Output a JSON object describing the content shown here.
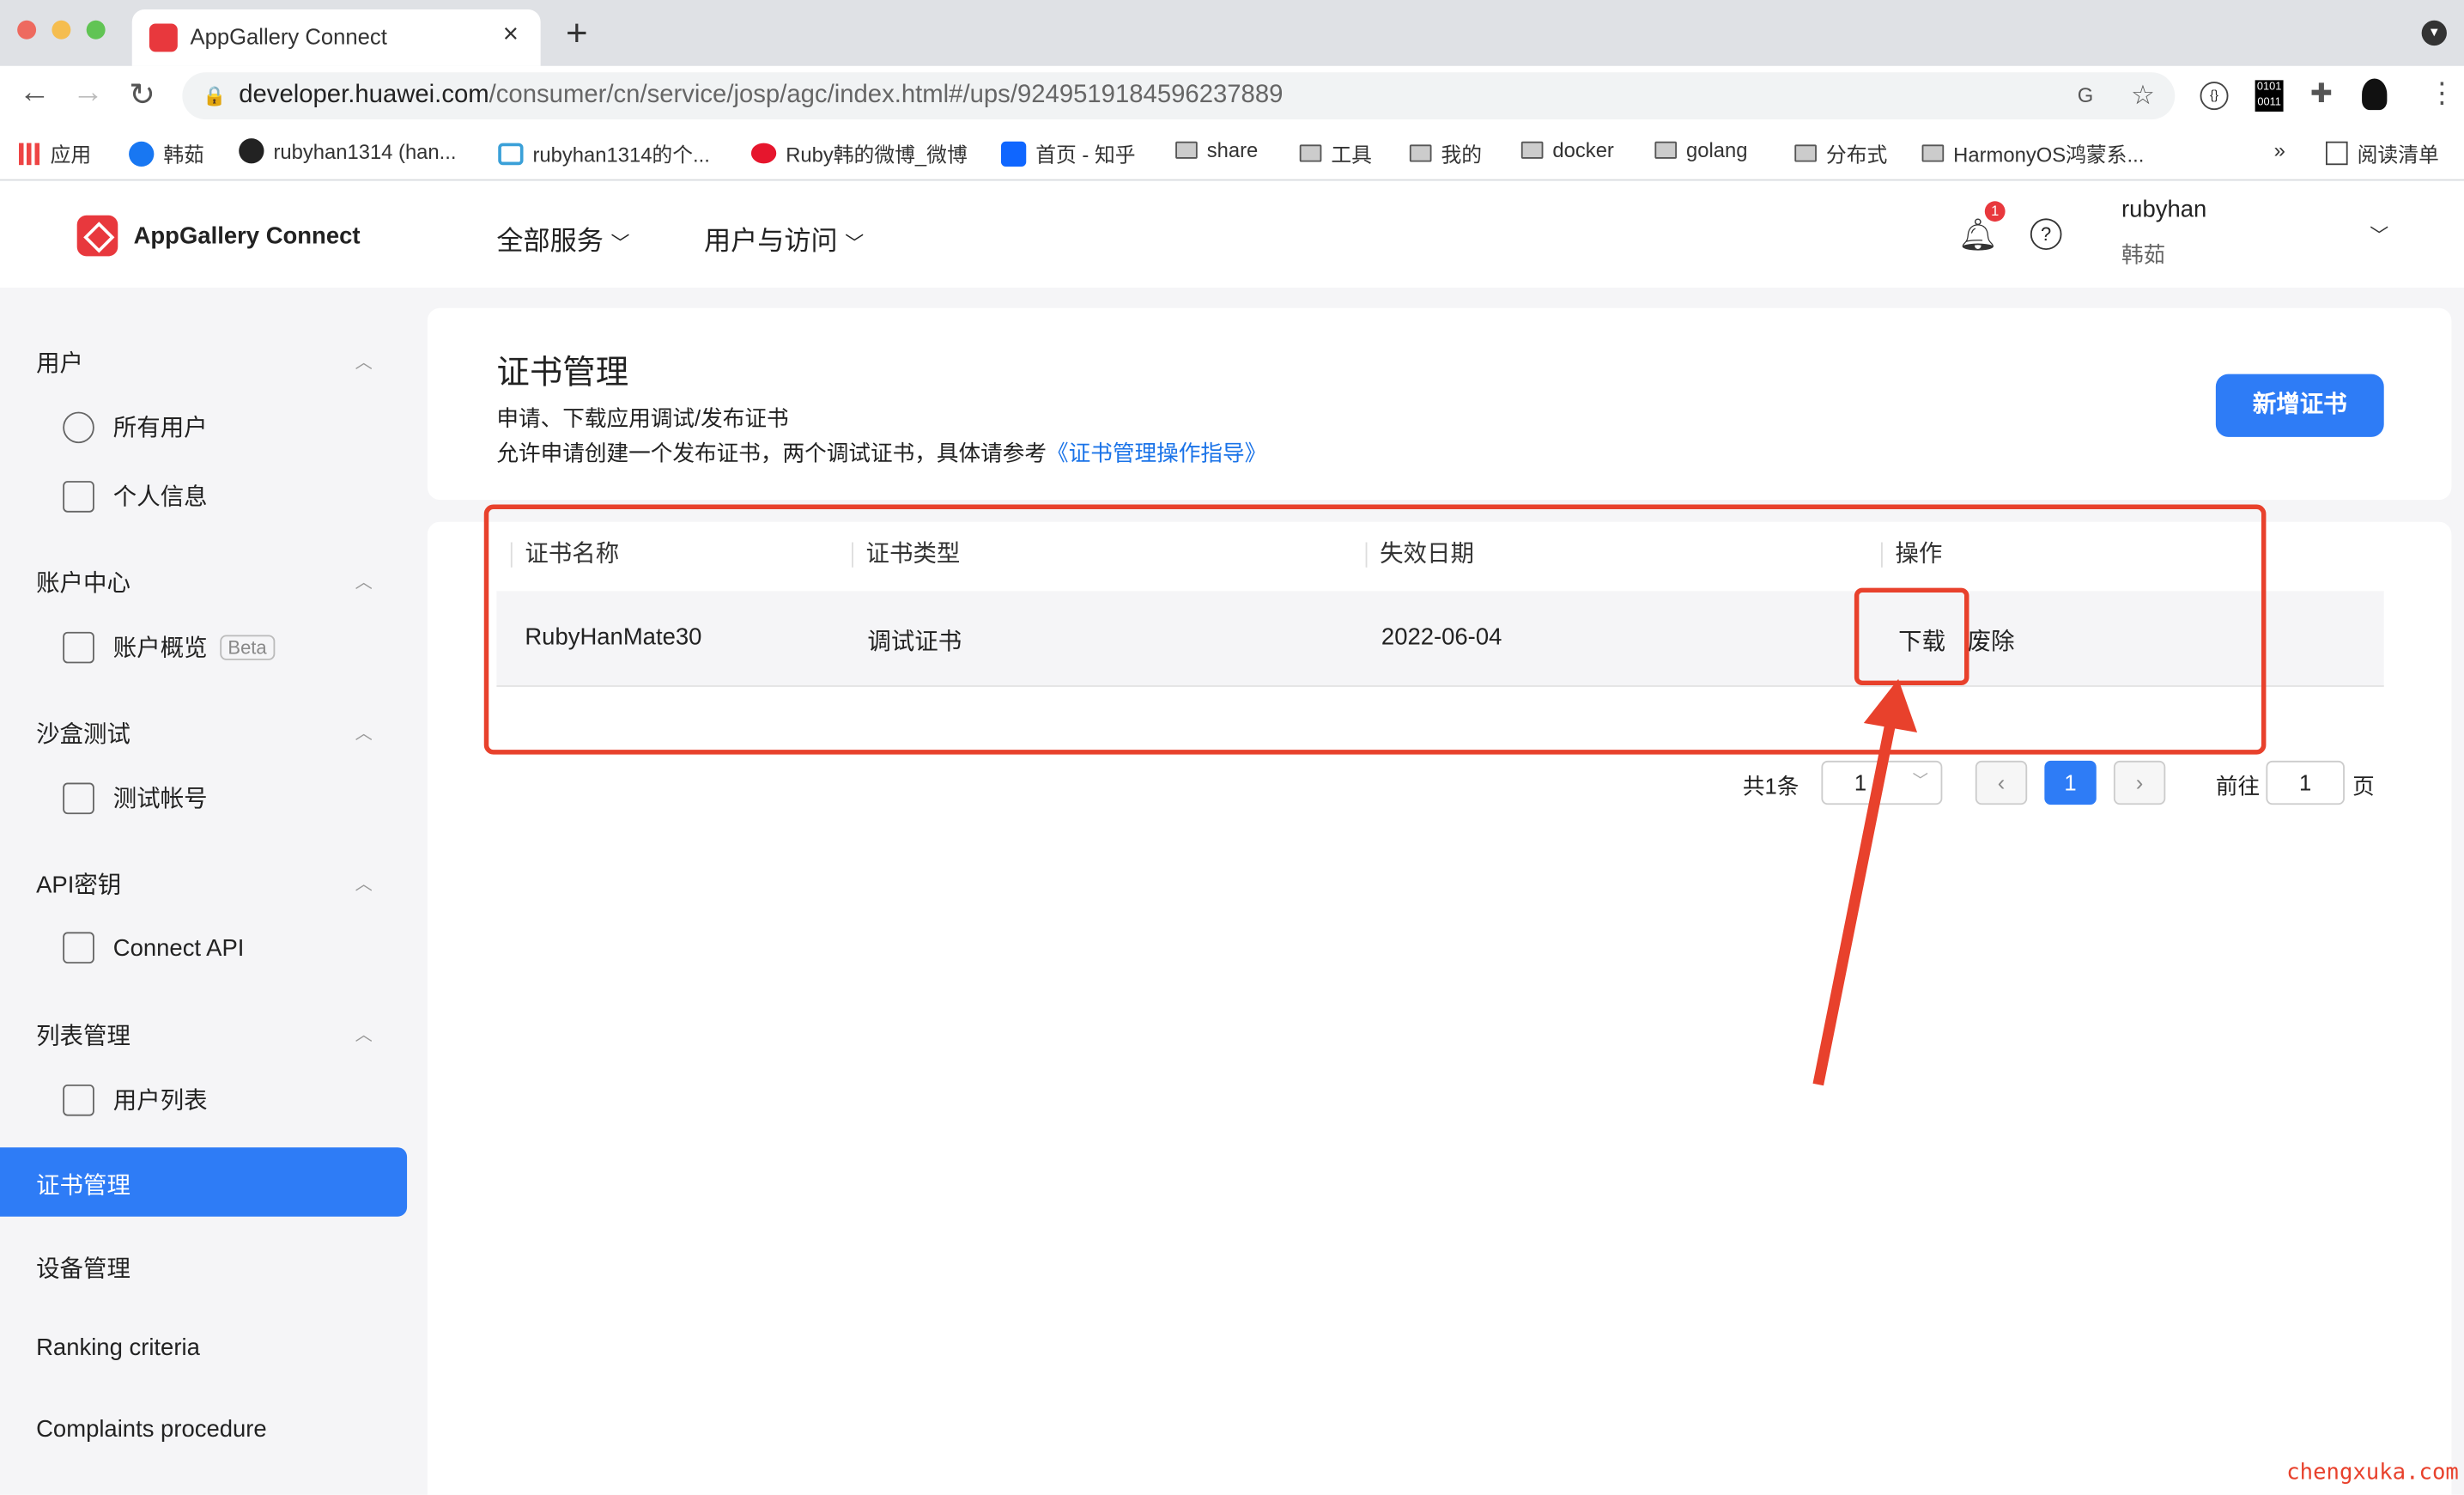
{
  "browser": {
    "tab_title": "AppGallery Connect",
    "url_host": "developer.huawei.com",
    "url_path": "/consumer/cn/service/josp/agc/index.html#/ups/9249519184596237889",
    "bookmarks": [
      "应用",
      "韩茹",
      "rubyhan1314 (han...",
      "rubyhan1314的个...",
      "Ruby韩的微博_微博",
      "首页 - 知乎",
      "share",
      "工具",
      "我的",
      "docker",
      "golang",
      "分布式",
      "HarmonyOS鸿蒙系..."
    ],
    "more": "»",
    "reading_list": "阅读清单"
  },
  "header": {
    "logo": "AppGallery Connect",
    "nav": [
      "全部服务",
      "用户与访问"
    ],
    "badge": "1",
    "user": "rubyhan",
    "user_sub": "韩茹"
  },
  "sidebar": {
    "groups": [
      {
        "title": "用户",
        "items": [
          "所有用户",
          "个人信息"
        ]
      },
      {
        "title": "账户中心",
        "items": [
          "账户概览"
        ],
        "tag": "Beta"
      },
      {
        "title": "沙盒测试",
        "items": [
          "测试帐号"
        ]
      },
      {
        "title": "API密钥",
        "items": [
          "Connect API"
        ]
      },
      {
        "title": "列表管理",
        "items": [
          "用户列表"
        ]
      }
    ],
    "items": [
      "证书管理",
      "设备管理",
      "Ranking criteria",
      "Complaints procedure"
    ],
    "active": "证书管理"
  },
  "page": {
    "title": "证书管理",
    "desc1": "申请、下载应用调试/发布证书",
    "desc2": "允许申请创建一个发布证书，两个调试证书，具体请参考",
    "guide_link": "《证书管理操作指导》",
    "add_button": "新增证书"
  },
  "table": {
    "columns": [
      "证书名称",
      "证书类型",
      "失效日期",
      "操作"
    ],
    "rows": [
      {
        "name": "RubyHanMate30",
        "type": "调试证书",
        "expiry": "2022-06-04",
        "download": "下载",
        "revoke": "废除"
      }
    ]
  },
  "pagination": {
    "total": "共1条",
    "page_size": "1",
    "current": "1",
    "goto_label": "前往",
    "goto_value": "1",
    "page_unit": "页"
  },
  "annotation_color": "#e8412c",
  "watermark": "chengxuka.com"
}
